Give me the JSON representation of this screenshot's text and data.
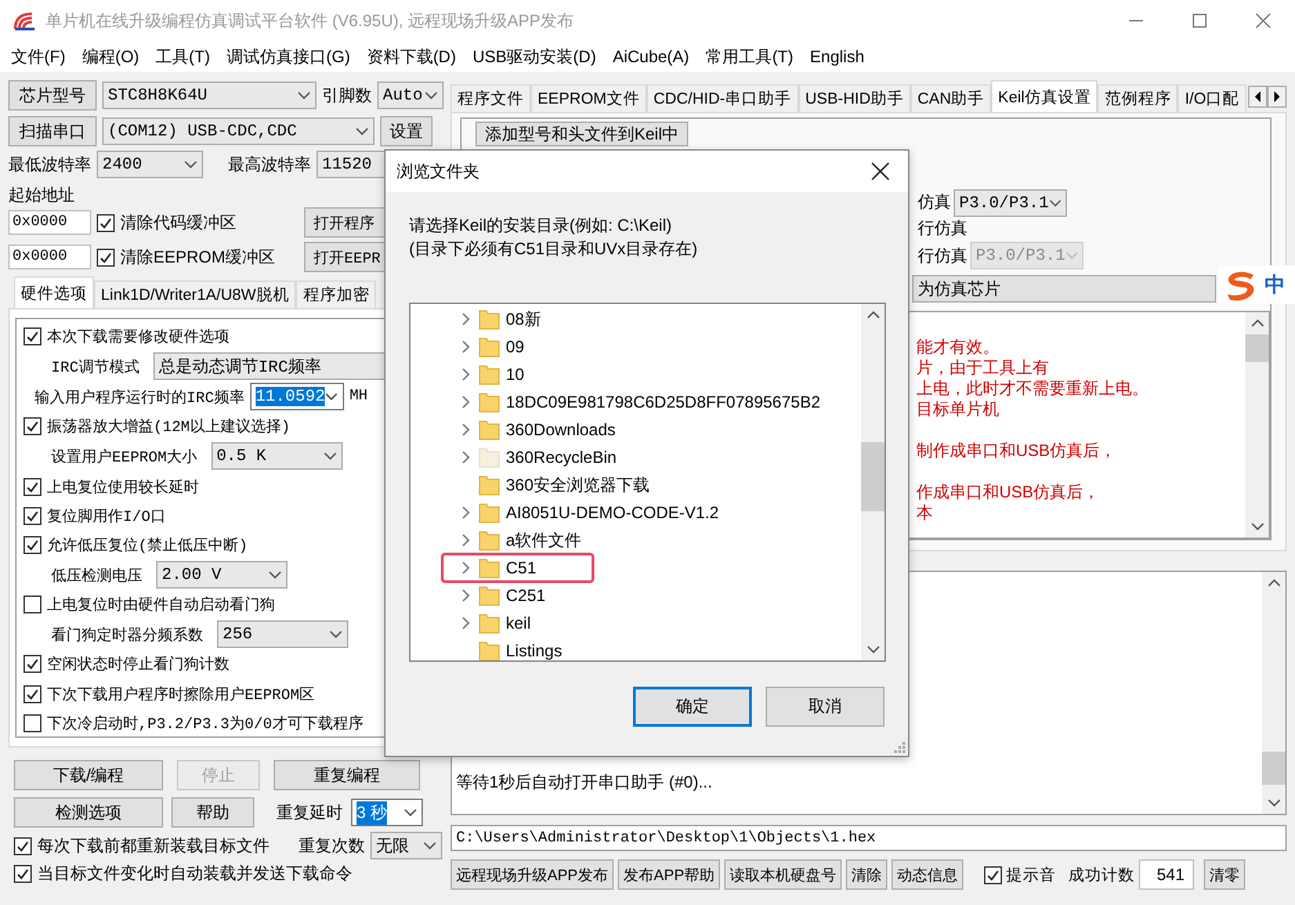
{
  "window": {
    "title": "单片机在线升级编程仿真调试平台软件 (V6.95U), 远程现场升级APP发布"
  },
  "menu": [
    "文件(F)",
    "编程(O)",
    "工具(T)",
    "调试仿真接口(G)",
    "资料下载(D)",
    "USB驱动安装(D)",
    "AiCube(A)",
    "常用工具(T)",
    "English"
  ],
  "chip": {
    "button": "芯片型号",
    "value": "STC8H8K64U",
    "pins_label": "引脚数",
    "pins": "Auto"
  },
  "port": {
    "button": "扫描串口",
    "value": "(COM12) USB-CDC,CDC",
    "settings": "设置"
  },
  "baud": {
    "min_label": "最低波特率",
    "min": "2400",
    "max_label": "最高波特率",
    "max": "11520"
  },
  "start_address": {
    "label": "起始地址",
    "rows": [
      {
        "value": "0x0000",
        "checkbox": "清除代码缓冲区",
        "checked": true,
        "button": "打开程序"
      },
      {
        "value": "0x0000",
        "checkbox": "清除EEPROM缓冲区",
        "checked": true,
        "button": "打开EEPR"
      }
    ]
  },
  "left_tabs": [
    {
      "label": "硬件选项",
      "selected": true
    },
    {
      "label": "Link1D/Writer1A/U8W脱机",
      "selected": false
    },
    {
      "label": "程序加密",
      "selected": false
    }
  ],
  "options": [
    {
      "kind": "check",
      "label": "本次下载需要修改硬件选项",
      "checked": true
    },
    {
      "kind": "combo",
      "label": "IRC调节模式",
      "value": "总是动态调节IRC频率"
    },
    {
      "kind": "entry",
      "label": "输入用户程序运行时的IRC频率",
      "value": "11.0592",
      "highlighted": true,
      "unit": "MH"
    },
    {
      "kind": "check",
      "label": "振荡器放大增益(12M以上建议选择)",
      "checked": true
    },
    {
      "kind": "combo",
      "label": "设置用户EEPROM大小",
      "value": "0.5 K"
    },
    {
      "kind": "check",
      "label": "上电复位使用较长延时",
      "checked": true
    },
    {
      "kind": "check",
      "label": "复位脚用作I/O口",
      "checked": true
    },
    {
      "kind": "check",
      "label": "允许低压复位(禁止低压中断)",
      "checked": true
    },
    {
      "kind": "combo",
      "label": "低压检测电压",
      "value": "2.00 V"
    },
    {
      "kind": "check",
      "label": "上电复位时由硬件自动启动看门狗",
      "checked": false
    },
    {
      "kind": "combo",
      "label": "看门狗定时器分频系数",
      "value": "256"
    },
    {
      "kind": "check",
      "label": "空闲状态时停止看门狗计数",
      "checked": true
    },
    {
      "kind": "check",
      "label": "下次下载用户程序时擦除用户EEPROM区",
      "checked": true
    },
    {
      "kind": "check",
      "label": "下次冷启动时,P3.2/P3.3为0/0才可下载程序",
      "checked": false
    }
  ],
  "actions": [
    {
      "label": "下载/编程",
      "disabled": false
    },
    {
      "label": "停止",
      "disabled": true
    },
    {
      "label": "重复编程",
      "disabled": false
    },
    {
      "label": "检测选项",
      "disabled": false
    },
    {
      "label": "帮助",
      "disabled": false
    }
  ],
  "repeat": {
    "delay_label": "重复延时",
    "delay": "3 秒",
    "delay_highlighted": true,
    "count_label": "重复次数",
    "count": "无限"
  },
  "auto_checks": [
    {
      "label": "每次下载前都重新装载目标文件",
      "checked": true
    },
    {
      "label": "当目标文件变化时自动装载并发送下载命令",
      "checked": true
    }
  ],
  "right_tabs": [
    {
      "label": "程序文件",
      "selected": false
    },
    {
      "label": "EEPROM文件",
      "selected": false
    },
    {
      "label": "CDC/HID-串口助手",
      "selected": false
    },
    {
      "label": "USB-HID助手",
      "selected": false
    },
    {
      "label": "CAN助手",
      "selected": false
    },
    {
      "label": "Keil仿真设置",
      "selected": true
    },
    {
      "label": "范例程序",
      "selected": false
    },
    {
      "label": "I/O口配",
      "selected": false
    }
  ],
  "keil": {
    "add_button": "添加型号和头文件到Keil中",
    "rows": [
      {
        "label": "仿真",
        "value": "P3.0/P3.1",
        "disabled": false
      },
      {
        "label": "行仿真"
      },
      {
        "label": "行仿真",
        "value": "P3.0/P3.1",
        "disabled": true
      }
    ],
    "chip_button": "为仿真芯片",
    "paragraphs": [
      [
        "能才有效。",
        "片，由于工具上有",
        "上电，此时才不需要重新上电。",
        "目标单片机"
      ],
      [
        "制作成串口和USB仿真后，"
      ],
      [
        "作成串口和USB仿真后，",
        "本"
      ]
    ]
  },
  "log": {
    "text": "等待1秒后自动打开串口助手 (#0)..."
  },
  "file_path": "C:\\Users\\Administrator\\Desktop\\1\\Objects\\1.hex",
  "bottom": {
    "buttons": [
      "远程现场升级APP发布",
      "发布APP帮助",
      "读取本机硬盘号",
      "清除",
      "动态信息"
    ],
    "sound": {
      "label": "提示音",
      "checked": true
    },
    "count_label": "成功计数",
    "count": "541",
    "reset": "清零"
  },
  "ime": {
    "label": "中"
  },
  "dialog": {
    "title": "浏览文件夹",
    "prompt": [
      "请选择Keil的安装目录(例如: C:\\Keil)",
      "(目录下必须有C51目录和UVx目录存在)"
    ],
    "folders": [
      {
        "name": "08新",
        "expandable": true,
        "faded": false,
        "highlighted": false
      },
      {
        "name": "09",
        "expandable": true,
        "faded": false,
        "highlighted": false
      },
      {
        "name": "10",
        "expandable": true,
        "faded": false,
        "highlighted": false
      },
      {
        "name": "18DC09E981798C6D25D8FF07895675B2",
        "expandable": true,
        "faded": false,
        "highlighted": false
      },
      {
        "name": "360Downloads",
        "expandable": true,
        "faded": false,
        "highlighted": false
      },
      {
        "name": "360RecycleBin",
        "expandable": true,
        "faded": true,
        "highlighted": false
      },
      {
        "name": "360安全浏览器下载",
        "expandable": false,
        "faded": false,
        "highlighted": false
      },
      {
        "name": "AI8051U-DEMO-CODE-V1.2",
        "expandable": true,
        "faded": false,
        "highlighted": false
      },
      {
        "name": "a软件文件",
        "expandable": true,
        "faded": false,
        "highlighted": false
      },
      {
        "name": "C51",
        "expandable": true,
        "faded": false,
        "highlighted": true
      },
      {
        "name": "C251",
        "expandable": true,
        "faded": false,
        "highlighted": false
      },
      {
        "name": "keil",
        "expandable": true,
        "faded": false,
        "highlighted": false
      },
      {
        "name": "Listings",
        "expandable": false,
        "faded": false,
        "highlighted": false
      }
    ],
    "ok": "确定",
    "cancel": "取消"
  }
}
